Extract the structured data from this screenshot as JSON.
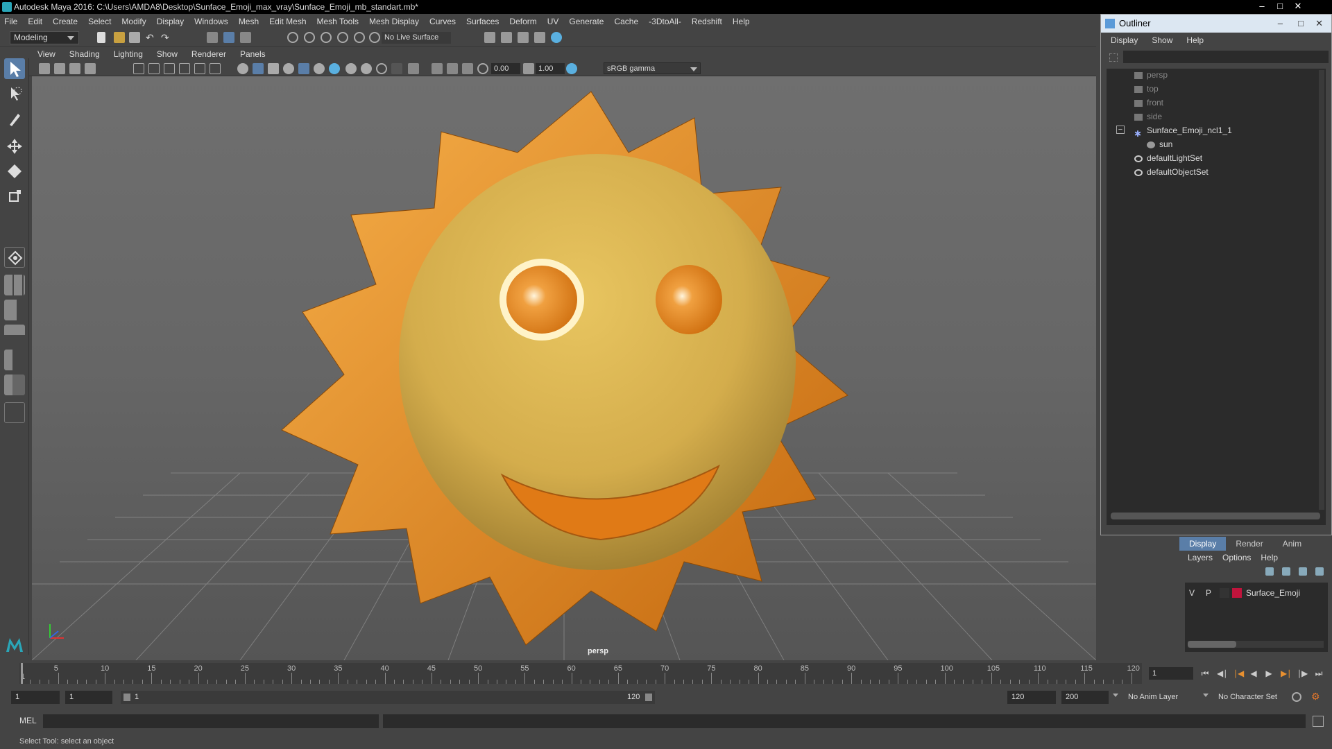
{
  "window": {
    "title": "Autodesk Maya 2016: C:\\Users\\AMDA8\\Desktop\\Sunface_Emoji_max_vray\\Sunface_Emoji_mb_standart.mb*"
  },
  "menubar": [
    "File",
    "Edit",
    "Create",
    "Select",
    "Modify",
    "Display",
    "Windows",
    "Mesh",
    "Edit Mesh",
    "Mesh Tools",
    "Mesh Display",
    "Curves",
    "Surfaces",
    "Deform",
    "UV",
    "Generate",
    "Cache",
    "-3DtoAll-",
    "Redshift",
    "Help"
  ],
  "statusline": {
    "mode": "Modeling",
    "live_surface": "No Live Surface"
  },
  "viewport": {
    "menu": [
      "View",
      "Shading",
      "Lighting",
      "Show",
      "Renderer",
      "Panels"
    ],
    "exposure": "0.00",
    "gamma_value": "1.00",
    "color_space": "sRGB gamma",
    "camera_label": "persp",
    "colors": {
      "sun_face": "#dcb34f",
      "sun_rays": "#e88c1a",
      "background": "#6a6a6a"
    }
  },
  "outliner": {
    "title": "Outliner",
    "menu": [
      "Display",
      "Show",
      "Help"
    ],
    "items": [
      {
        "label": "persp",
        "type": "camera"
      },
      {
        "label": "top",
        "type": "camera"
      },
      {
        "label": "front",
        "type": "camera"
      },
      {
        "label": "side",
        "type": "camera"
      },
      {
        "label": "Sunface_Emoji_ncl1_1",
        "type": "group"
      },
      {
        "label": "sun",
        "type": "mesh"
      },
      {
        "label": "defaultLightSet",
        "type": "set"
      },
      {
        "label": "defaultObjectSet",
        "type": "set"
      }
    ]
  },
  "channel_box": {
    "tabs": [
      "Display",
      "Render",
      "Anim"
    ],
    "menu": [
      "Layers",
      "Options",
      "Help"
    ],
    "layer": {
      "v": "V",
      "p": "P",
      "name": "Surface_Emoji",
      "color": "#c0143c"
    }
  },
  "timeline": {
    "ticks": [
      "5",
      "10",
      "15",
      "20",
      "25",
      "30",
      "35",
      "40",
      "45",
      "50",
      "55",
      "60",
      "65",
      "70",
      "75",
      "80",
      "85",
      "90",
      "95",
      "100",
      "105",
      "110",
      "115",
      "120"
    ],
    "start_tick": "1",
    "current_frame": "1"
  },
  "range": {
    "start": "1",
    "playback_start": "1",
    "slider_start": "1",
    "slider_end": "120",
    "playback_end": "120",
    "end": "200",
    "anim_layer": "No Anim Layer",
    "character_set": "No Character Set"
  },
  "cmdline": {
    "label": "MEL"
  },
  "helpline": {
    "text": "Select Tool: select an object"
  }
}
